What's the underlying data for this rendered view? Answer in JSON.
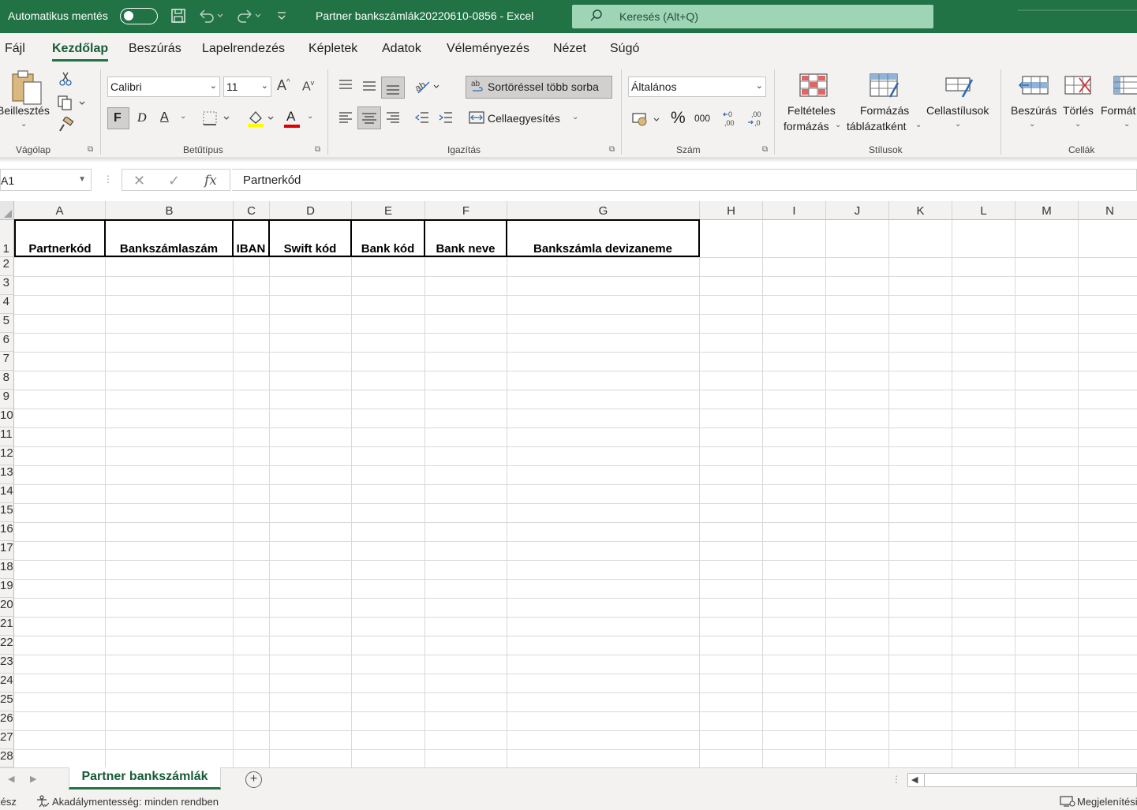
{
  "titlebar": {
    "autosave_label": "Automatikus mentés",
    "doc_title": "Partner bankszámlák20220610-0856  -  Excel",
    "search_placeholder": "Keresés (Alt+Q)"
  },
  "menu": {
    "tabs": [
      "Fájl",
      "Kezdőlap",
      "Beszúrás",
      "Lapelrendezés",
      "Képletek",
      "Adatok",
      "Véleményezés",
      "Nézet",
      "Súgó"
    ],
    "active": "Kezdőlap"
  },
  "ribbon": {
    "clipboard": {
      "paste": "Beillesztés",
      "group": "Vágólap"
    },
    "font": {
      "name": "Calibri",
      "size": "11",
      "bold": "F",
      "italic": "D",
      "underline": "A",
      "color": "A",
      "group": "Betűtípus"
    },
    "alignment": {
      "wrap": "Sortöréssel több sorba",
      "merge": "Cellaegyesítés",
      "group": "Igazítás"
    },
    "number": {
      "format": "Általános",
      "percent": "%",
      "thousands": "000",
      "group": "Szám"
    },
    "styles": {
      "conditional_1": "Feltételes",
      "conditional_2": "formázás",
      "table_1": "Formázás",
      "table_2": "táblázatként",
      "cell_styles": "Cellastílusok",
      "group": "Stílusok"
    },
    "cells": {
      "insert": "Beszúrás",
      "delete": "Törlés",
      "format": "Formát",
      "group": "Cellák"
    }
  },
  "formula_bar": {
    "name_box": "A1",
    "fx": "fx",
    "content": "Partnerkód"
  },
  "sheet": {
    "columns": [
      "A",
      "B",
      "C",
      "D",
      "E",
      "F",
      "G",
      "H",
      "I",
      "J",
      "K",
      "L",
      "M",
      "N"
    ],
    "rows": [
      "1",
      "2",
      "3",
      "4",
      "5",
      "6",
      "7",
      "8",
      "9",
      "10",
      "11",
      "12",
      "13",
      "14",
      "15",
      "16",
      "17",
      "18",
      "19",
      "20",
      "21",
      "22",
      "23",
      "24",
      "25",
      "26",
      "27",
      "28"
    ],
    "headers": [
      "Partnerkód",
      "Bankszámlaszám",
      "IBAN",
      "Swift kód",
      "Bank kód",
      "Bank neve",
      "Bankszámla devizaneme"
    ]
  },
  "sheet_tabs": {
    "active": "Partner bankszámlák",
    "add": "+"
  },
  "status": {
    "mode": "Kész",
    "accessibility": "Akadálymentesség: minden rendben",
    "display": "Megjelenítési"
  }
}
